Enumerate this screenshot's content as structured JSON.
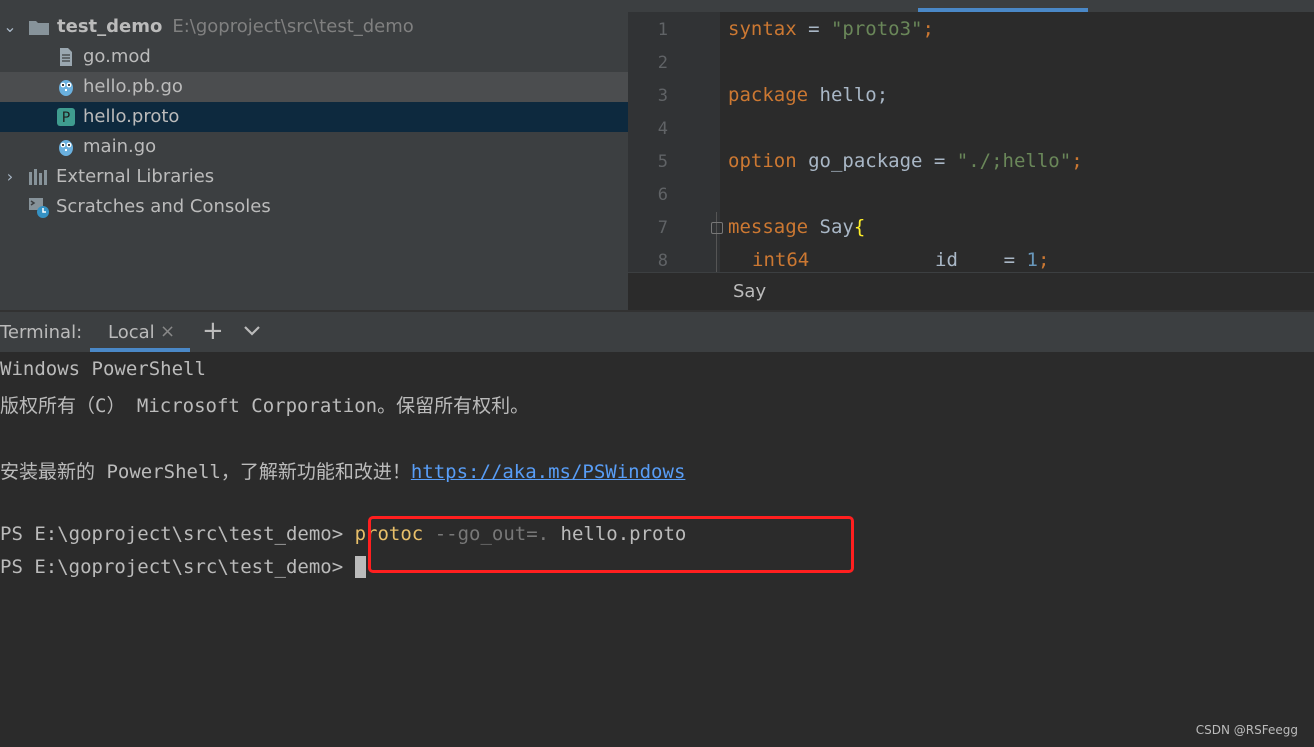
{
  "project": {
    "rows": [
      {
        "name": "test_demo",
        "path": "E:\\goproject\\src\\test_demo",
        "icon": "folder-icon"
      },
      {
        "name": "go.mod",
        "icon": "file-icon"
      },
      {
        "name": "hello.pb.go",
        "icon": "gopher-icon"
      },
      {
        "name": "hello.proto",
        "icon": "proto-file-icon",
        "icon_letter": "P"
      },
      {
        "name": "main.go",
        "icon": "gopher-icon"
      },
      {
        "name": "External Libraries",
        "icon": "libraries-icon"
      },
      {
        "name": "Scratches and Consoles",
        "icon": "scratches-icon"
      }
    ]
  },
  "editor": {
    "line_numbers": [
      "1",
      "2",
      "3",
      "4",
      "5",
      "6",
      "7",
      "8"
    ],
    "code": {
      "line1": {
        "kw": "syntax",
        "op": " = ",
        "str": "\"proto3\"",
        "end": ";"
      },
      "line3": {
        "kw": "package",
        "rest": " hello;"
      },
      "line5": {
        "kw": "option",
        "rest": " go_package = ",
        "str": "\"./;hello\"",
        "end": ";"
      },
      "line7": {
        "kw": "message",
        "rest": " Say",
        "brace": "{"
      },
      "line8": {
        "kw": "int64",
        "rest": "           id    = ",
        "num": "1",
        "end": ";"
      }
    },
    "breadcrumb": "Say"
  },
  "terminal": {
    "title": "Terminal:",
    "tab_label": "Local",
    "close_glyph": "×",
    "add_glyph": "+",
    "lines": {
      "l1": "Windows PowerShell",
      "l2": "版权所有（C） Microsoft Corporation。保留所有权利。",
      "l4_text": "安装最新的 PowerShell，了解新功能和改进！",
      "l4_link": "https://aka.ms/PSWindows",
      "prompt": "PS E:\\goproject\\src\\test_demo> ",
      "cmd": "protoc",
      "flag": " --go_out=.",
      "arg": " hello.proto"
    }
  },
  "watermark": "CSDN @RSFeegg",
  "colors": {
    "highlight_box": "#ff1f1f",
    "selection": "#0d293e",
    "accent": "#4a88c7"
  }
}
